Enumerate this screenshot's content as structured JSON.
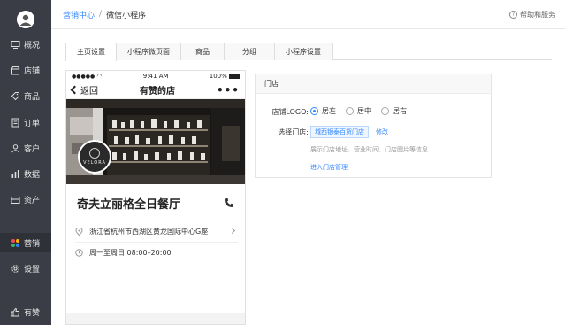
{
  "sidebar": {
    "items": [
      {
        "label": "概况",
        "icon": "monitor-icon"
      },
      {
        "label": "店铺",
        "icon": "store-icon"
      },
      {
        "label": "商品",
        "icon": "tag-icon"
      },
      {
        "label": "订单",
        "icon": "order-icon"
      },
      {
        "label": "客户",
        "icon": "user-icon"
      },
      {
        "label": "数据",
        "icon": "chart-icon"
      },
      {
        "label": "资产",
        "icon": "wallet-icon"
      },
      {
        "label": "营销",
        "icon": "apps-icon"
      },
      {
        "label": "设置",
        "icon": "gear-icon"
      },
      {
        "label": "有赞",
        "icon": "thumb-icon"
      }
    ]
  },
  "header": {
    "crumb_root": "营销中心",
    "separator": "/",
    "crumb_current": "微信小程序",
    "help_label": "帮助和服务"
  },
  "tabs": [
    {
      "label": "主页设置"
    },
    {
      "label": "小程序微页面"
    },
    {
      "label": "商品"
    },
    {
      "label": "分组"
    },
    {
      "label": "小程序设置"
    }
  ],
  "phone": {
    "carrier": "●●●●●",
    "time": "9:41 AM",
    "battery": "100%",
    "back_label": "返回",
    "nav_title": "有赞的店",
    "more": "•••",
    "logo_text": "VELORA",
    "store_name": "奇夫立丽格全日餐厅",
    "address": "浙江省杭州市西湖区黄龙国际中心G座",
    "hours": "周一至周日 08:00–20:00"
  },
  "settings": {
    "section_title": "门店",
    "logo_label": "店铺LOGO:",
    "logo_options": [
      "居左",
      "居中",
      "居右"
    ],
    "logo_selected": "居左",
    "store_label": "选择门店:",
    "store_value": "城西银泰百货门店",
    "edit_label": "修改",
    "hint": "展示门店地址、营业时间、门店图片等信息",
    "enter_link": "进入门店管理"
  },
  "colors": {
    "sidebar_bg": "#3a3d45",
    "accent": "#3388ff"
  }
}
